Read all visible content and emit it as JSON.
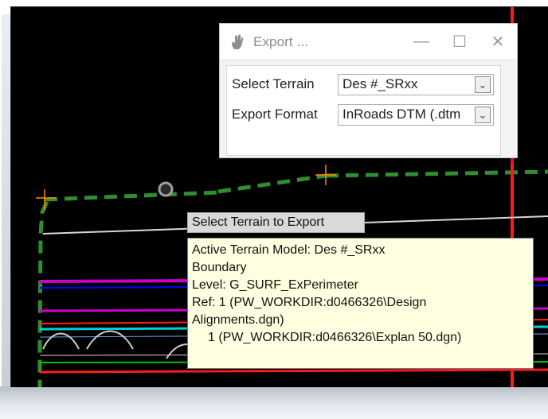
{
  "dialog": {
    "title": "Export ...",
    "controls": {
      "minimize": "—",
      "maximize": "☐",
      "close": "✕"
    },
    "fields": [
      {
        "label": "Select Terrain",
        "value": "Des #_SRxx"
      },
      {
        "label": "Export Format",
        "value": "InRoads DTM (.dtm"
      }
    ]
  },
  "tooltip": {
    "title": "Select Terrain to Export",
    "lines": [
      "Active Terrain Model: Des #_SRxx",
      "Boundary",
      "Level: G_SURF_ExPerimeter",
      "Ref: 1 (PW_WORKDIR:d0466326\\Design",
      "Alignments.dgn)",
      "1 (PW_WORKDIR:d0466326\\Explan 50.dgn)"
    ]
  },
  "icons": {
    "dialog_icon": "hand-icon",
    "combo_arrow": "chevron-down-icon"
  },
  "colors": {
    "viewport": "#000000",
    "tooltip_background": "#ffffe1",
    "dialog_background": "#f3f3f3",
    "green_dash": "#2f8f2f",
    "red_line": "#ff1a1a",
    "orange_cross": "#ff8a00",
    "magenta_line": "#cc00cc"
  }
}
